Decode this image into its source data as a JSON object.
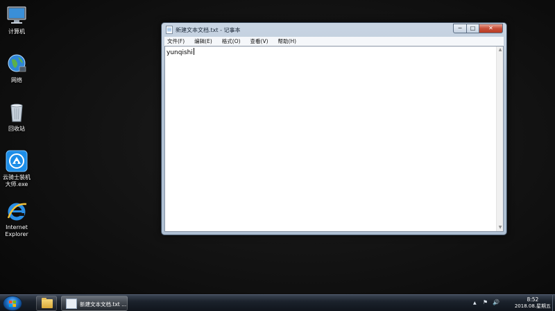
{
  "desktop": {
    "icons": [
      {
        "name": "computer-icon",
        "label": "计算机"
      },
      {
        "name": "network-icon",
        "label": "网络"
      },
      {
        "name": "recycle-bin-icon",
        "label": "回收站"
      },
      {
        "name": "yqs-installer-icon",
        "label": "云骑士装机\n大师.exe"
      },
      {
        "name": "ie-icon",
        "label": "Internet\nExplorer"
      }
    ]
  },
  "notepad": {
    "title": "新建文本文档.txt - 记事本",
    "controls": {
      "minimize": "─",
      "maximize": "□",
      "close": "✕"
    },
    "menu": [
      "文件(F)",
      "编辑(E)",
      "格式(O)",
      "查看(V)",
      "帮助(H)"
    ],
    "content": "yunqishi"
  },
  "taskbar": {
    "notepad_label": "新建文本文档.txt ...",
    "tray": {
      "up_arrow": "▲",
      "flag": "⚑",
      "volume": "🔊"
    },
    "time": "8:52",
    "date": "2018.08.星期五"
  },
  "colors": {
    "close_button": "#c7503a",
    "taskbar": "#1b222c",
    "start_orb": "#1d6fc4"
  }
}
